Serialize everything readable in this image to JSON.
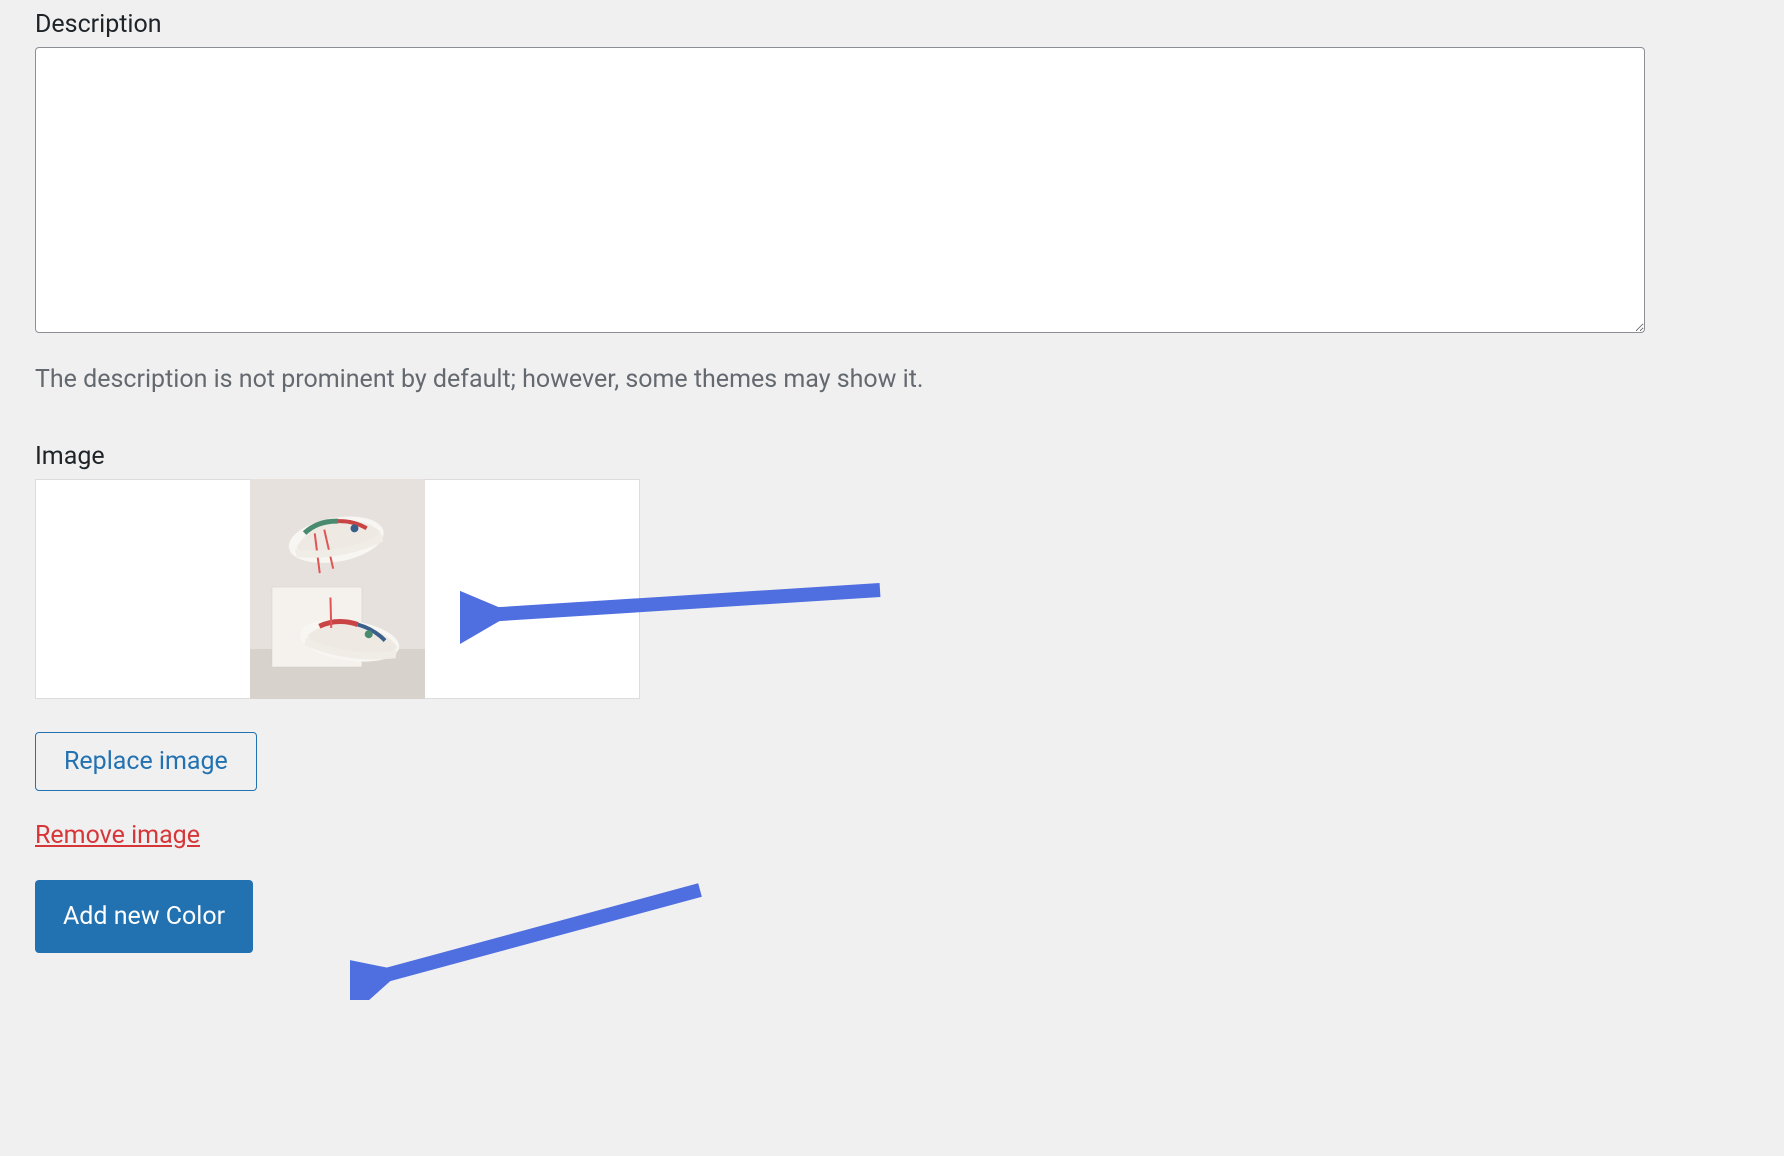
{
  "description": {
    "label": "Description",
    "value": "",
    "help_text": "The description is not prominent by default; however, some themes may show it."
  },
  "image": {
    "label": "Image",
    "replace_button_label": "Replace image",
    "remove_link_label": "Remove image"
  },
  "add_button_label": "Add new Color",
  "colors": {
    "page_bg": "#f0f0f1",
    "text_primary": "#1d2327",
    "text_muted": "#646970",
    "border": "#8c8f94",
    "primary": "#2271b1",
    "danger": "#d63638",
    "arrow": "#4f6ee0"
  }
}
